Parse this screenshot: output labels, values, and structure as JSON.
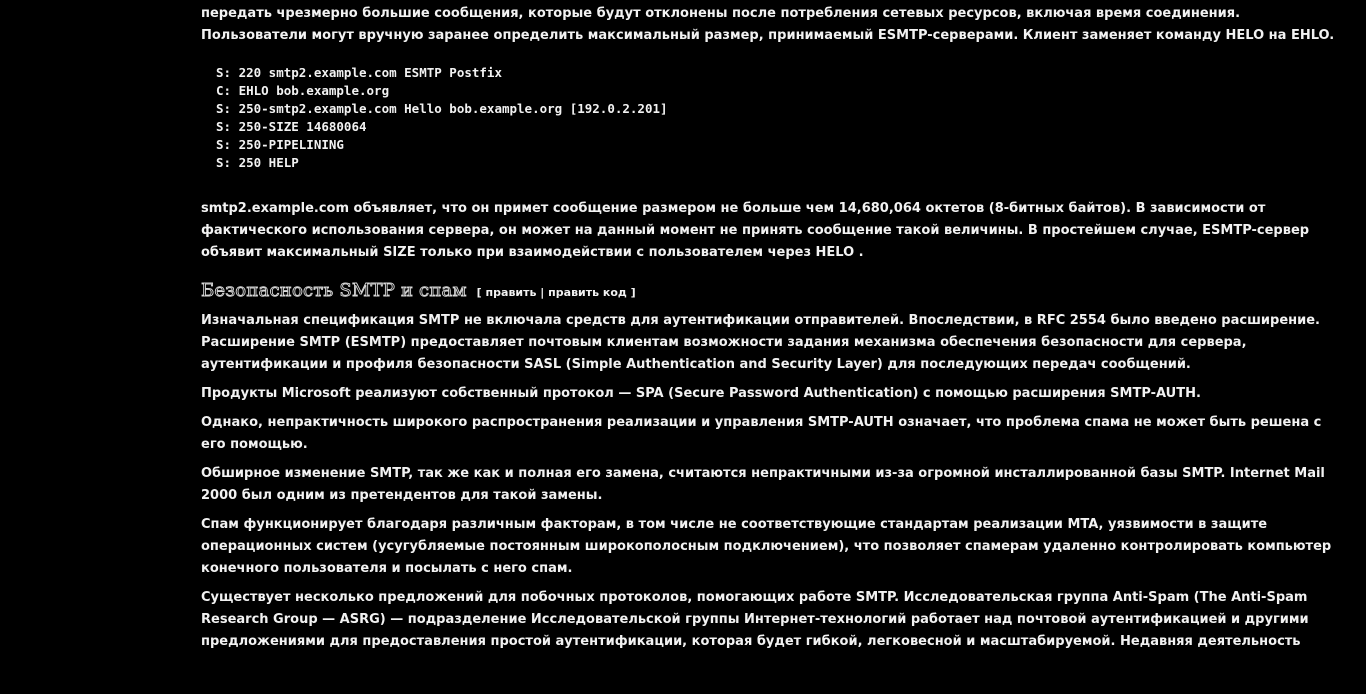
{
  "article": {
    "intro": "передать чрезмерно большие сообщения, которые будут отклонены после потребления сетевых ресурсов, включая время соединения. Пользователи могут вручную заранее определить максимальный размер, принимаемый ESMTP-серверами. Клиент заменяет команду  HELO  на EHLO.",
    "code_lines": [
      "S: 220 smtp2.example.com ESMTP Postfix",
      "C: EHLO bob.example.org",
      "S: 250-smtp2.example.com Hello bob.example.org [192.0.2.201]",
      "S: 250-SIZE 14680064",
      "S: 250-PIPELINING",
      "S: 250 HELP"
    ],
    "after_code": "smtp2.example.com объявляет, что он примет сообщение размером не больше чем 14,680,064 октетов (8-битных байтов). В зависимости от фактического использования сервера, он может на данный момент не принять сообщение такой величины. В простейшем случае, ESMTP-сервер объявит максимальный SIZE только при взаимодействии с пользователем через  HELO .",
    "section": {
      "title": "Безопасность SMTP и спам",
      "bracket_open": "[",
      "edit_label": "править",
      "separator": "|",
      "edit_code_label": "править код",
      "bracket_close": "]"
    },
    "paragraphs": [
      "Изначальная спецификация SMTP не включала средств для аутентификации отправителей. Впоследствии, в RFC 2554    было введено расширение. Расширение SMTP (ESMTP) предоставляет почтовым клиентам возможности задания механизма обеспечения безопасности для сервера, аутентификации и профиля безопасности SASL (Simple Authentication and Security Layer) для последующих передач сообщений.",
      "Продукты Microsoft реализуют собственный протокол — SPA (Secure Password Authentication) с помощью расширения SMTP-AUTH.",
      "Однако, непрактичность широкого распространения реализации и управления SMTP-AUTH означает, что проблема спама не может быть решена с его помощью.",
      "Обширное изменение SMTP, так же как и полная его замена, считаются непрактичными из-за огромной инсталлированной базы SMTP. Internet Mail 2000 был одним из претендентов для такой замены.",
      "Спам функционирует благодаря различным факторам, в том числе не соответствующие стандартам реализации MTA, уязвимости в защите операционных систем (усугубляемые постоянным широкополосным подключением), что позволяет спамерам удаленно контролировать компьютер конечного пользователя и посылать с него спам.",
      "Существует несколько предложений для побочных протоколов, помогающих работе SMTP. Исследовательская группа Anti-Spam (The Anti-Spam Research Group — ASRG) — подразделение Исследовательской группы Интернет-технологий работает над почтовой аутентификацией и другими предложениями для предоставления простой аутентификации, которая будет гибкой, легковесной и масштабируемой. Недавняя деятельность"
    ]
  },
  "colors": {
    "background": "#000000",
    "text": "#f2f2f2"
  }
}
